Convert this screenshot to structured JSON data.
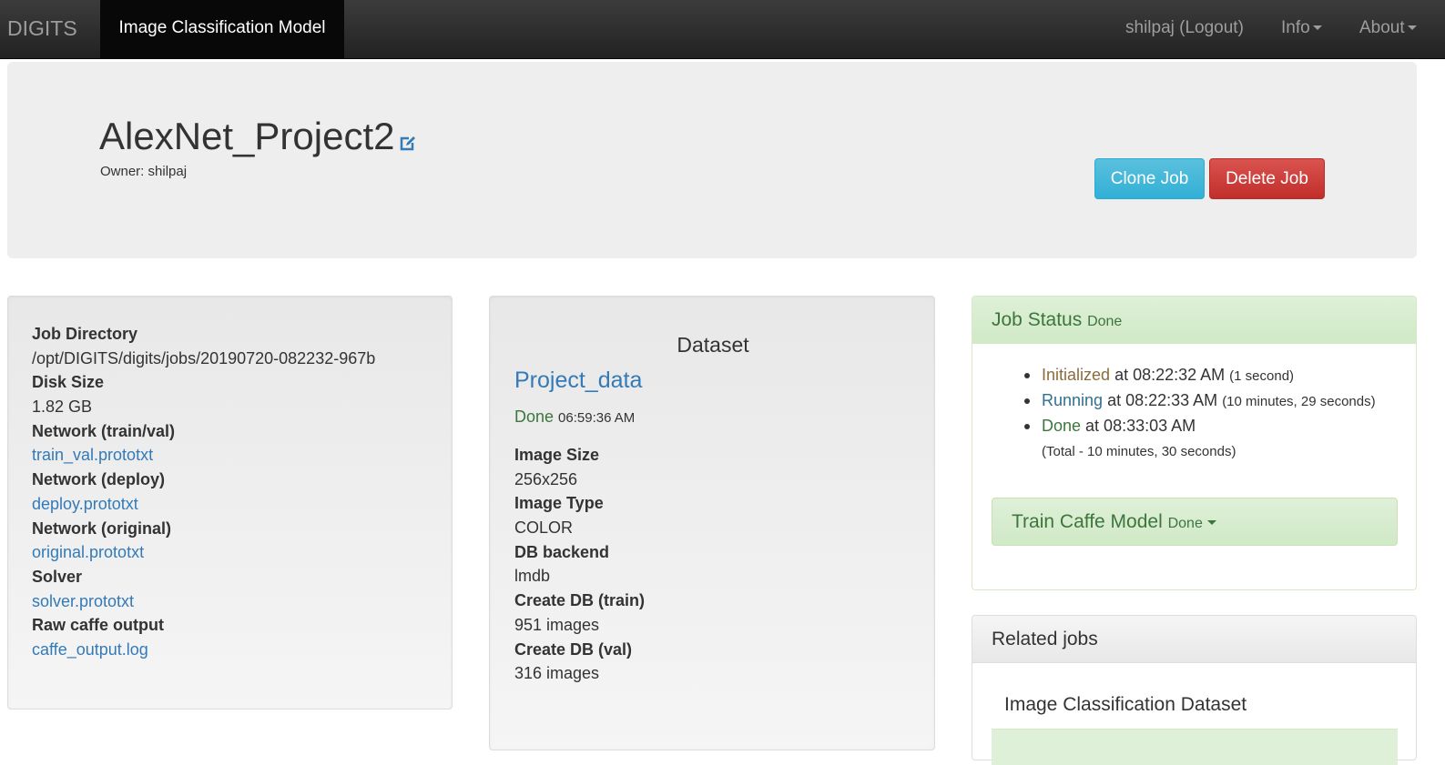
{
  "navbar": {
    "brand": "DIGITS",
    "active_page": "Image Classification Model",
    "user_logout": "shilpaj (Logout)",
    "info": "Info",
    "about": "About"
  },
  "job": {
    "name": "AlexNet_Project2",
    "owner": "Owner: shilpaj",
    "clone_label": "Clone Job",
    "delete_label": "Delete Job"
  },
  "job_info": [
    {
      "label": "Job Directory",
      "value": "/opt/DIGITS/digits/jobs/20190720-082232-967b",
      "link": false
    },
    {
      "label": "Disk Size",
      "value": "1.82 GB",
      "link": false
    },
    {
      "label": "Network (train/val)",
      "value": "train_val.prototxt",
      "link": true
    },
    {
      "label": "Network (deploy)",
      "value": "deploy.prototxt",
      "link": true
    },
    {
      "label": "Network (original)",
      "value": "original.prototxt",
      "link": true
    },
    {
      "label": "Solver",
      "value": "solver.prototxt",
      "link": true
    },
    {
      "label": "Raw caffe output",
      "value": "caffe_output.log",
      "link": true
    }
  ],
  "dataset": {
    "heading": "Dataset",
    "name": "Project_data",
    "status": "Done",
    "status_time": "06:59:36 AM",
    "fields": [
      {
        "label": "Image Size",
        "value": "256x256"
      },
      {
        "label": "Image Type",
        "value": "COLOR"
      },
      {
        "label": "DB backend",
        "value": "lmdb"
      },
      {
        "label": "Create DB (train)",
        "value": "951 images"
      },
      {
        "label": "Create DB (val)",
        "value": "316 images"
      }
    ]
  },
  "job_status": {
    "title": "Job Status",
    "state": "Done",
    "steps": [
      {
        "state": "Initialized",
        "time": "at 08:22:32 AM",
        "duration": "(1 second)"
      },
      {
        "state": "Running",
        "time": "at 08:22:33 AM",
        "duration": "(10 minutes, 29 seconds)"
      },
      {
        "state": "Done",
        "time": "at 08:33:03 AM",
        "duration": "(Total - 10 minutes, 30 seconds)"
      }
    ],
    "task_name": "Train Caffe Model",
    "task_state": "Done"
  },
  "related_jobs": {
    "title": "Related jobs",
    "item": "Image Classification Dataset"
  },
  "colors": {
    "navbar": "#222222",
    "primary_link": "#337ab7",
    "success_text": "#3c763d",
    "info_button": "#5bc0de",
    "danger_button": "#d9534f"
  }
}
